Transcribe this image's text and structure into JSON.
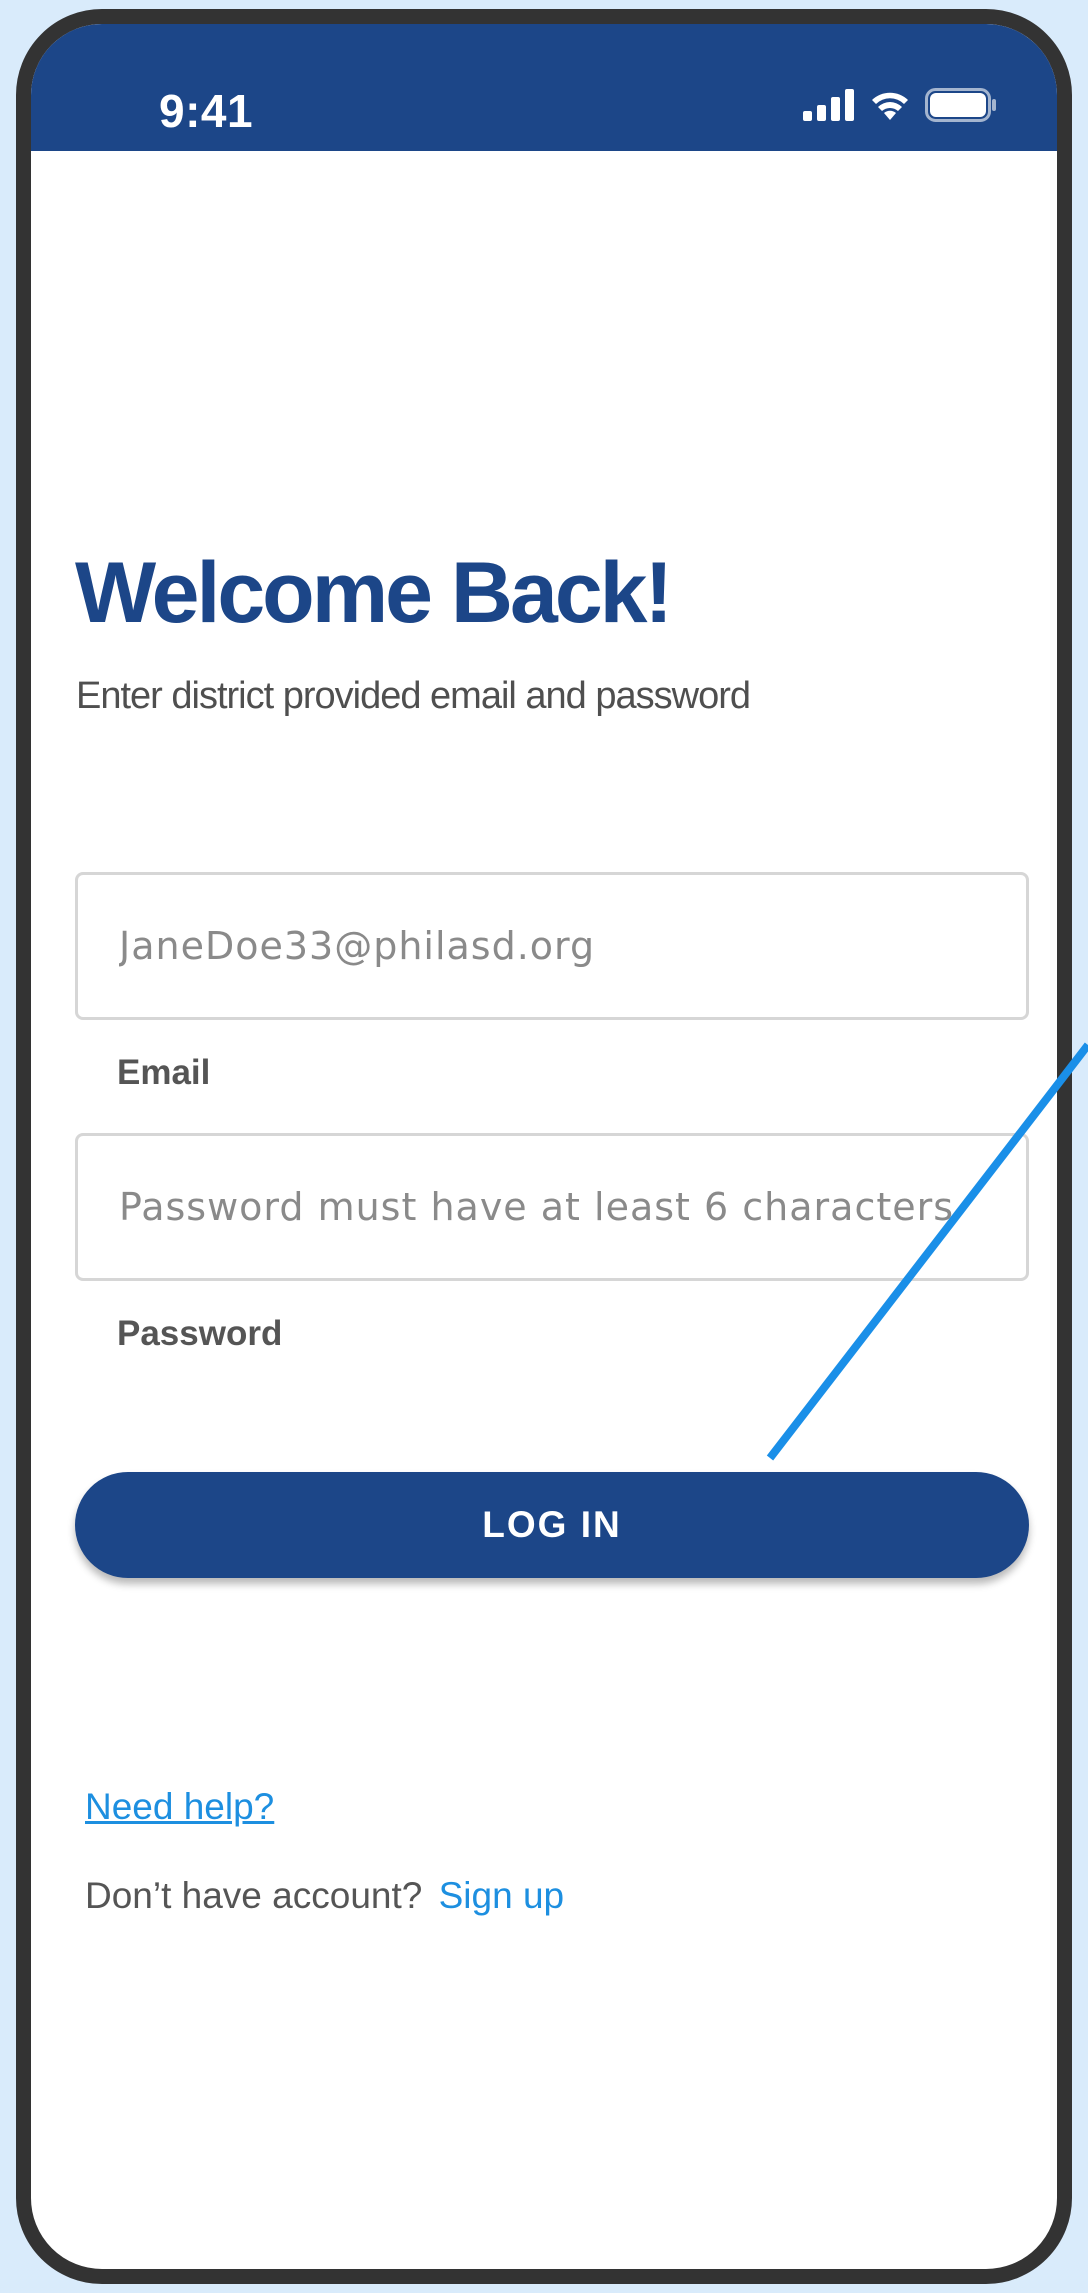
{
  "status_bar": {
    "time": "9:41",
    "icons": [
      "cellular-signal-icon",
      "wifi-icon",
      "battery-icon"
    ]
  },
  "login": {
    "title": "Welcome Back!",
    "subtitle": "Enter district provided email and password",
    "email": {
      "placeholder": "JaneDoe33@philasd.org",
      "label": "Email"
    },
    "password": {
      "placeholder": "Password must have at least 6 characters",
      "label": "Password"
    },
    "login_button": "LOG IN",
    "help_link": "Need help?",
    "signup_prompt": "Don’t have account?",
    "signup_link": "Sign up"
  },
  "colors": {
    "primary": "#1c4688",
    "link": "#1d8fe0",
    "annotation": "#1a8fe8",
    "background": "#d9ebfb"
  }
}
